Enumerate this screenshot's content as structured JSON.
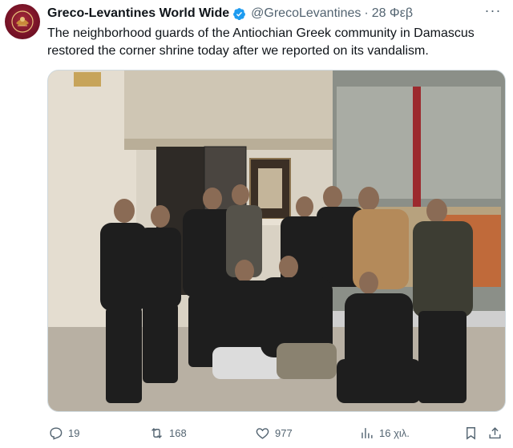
{
  "tweet": {
    "display_name": "Greco-Levantines World Wide",
    "handle": "@GrecoLevantines",
    "separator": "·",
    "date": "28 Φεβ",
    "text": "The neighborhood guards of the Antiochian Greek community in Damascus restored the corner shrine today after we reported on its vandalism.",
    "more_label": "···",
    "colors": {
      "verified": "#1d9bf0",
      "avatar": "#7a1428",
      "muted": "#536471"
    }
  },
  "actions": {
    "replies": "19",
    "retweets": "168",
    "likes": "977",
    "views": "16 χιλ."
  },
  "icons": [
    "reply-icon",
    "retweet-icon",
    "like-icon",
    "views-icon",
    "bookmark-icon",
    "share-icon",
    "verified-badge-icon",
    "more-icon"
  ]
}
